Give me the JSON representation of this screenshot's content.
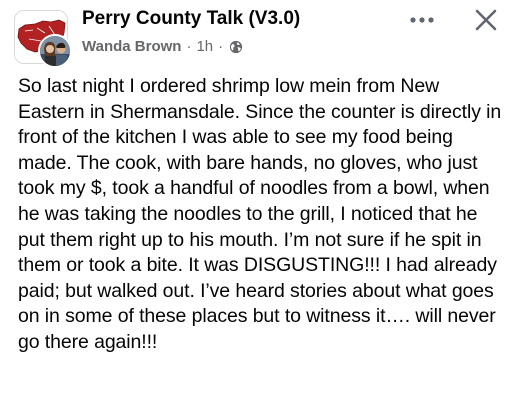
{
  "post": {
    "group_name": "Perry County Talk (V3.0)",
    "author": "Wanda Brown",
    "separator": "·",
    "time": "1h",
    "separator2": "·",
    "privacy_icon": "globe-icon",
    "more_icon": "more-options-icon",
    "close_icon": "close-icon",
    "body": "So last night I ordered shrimp low mein from New Eastern in Shermansdale. Since the counter is directly in front of the kitchen I was able to see my food being made. The cook, with bare hands, no gloves, who just took my $, took a handful of noodles from a bowl, when he was taking the noodles to the grill, I noticed that he put them right up to his mouth. I’m not sure if he spit in them or took a bite. It was DISGUSTING!!! I had already paid; but walked out. I’ve heard stories about what goes on in some of these places but to witness it…. will never go there again!!!"
  },
  "colors": {
    "text_primary": "#050505",
    "text_secondary": "#65676b",
    "background": "#ffffff"
  }
}
